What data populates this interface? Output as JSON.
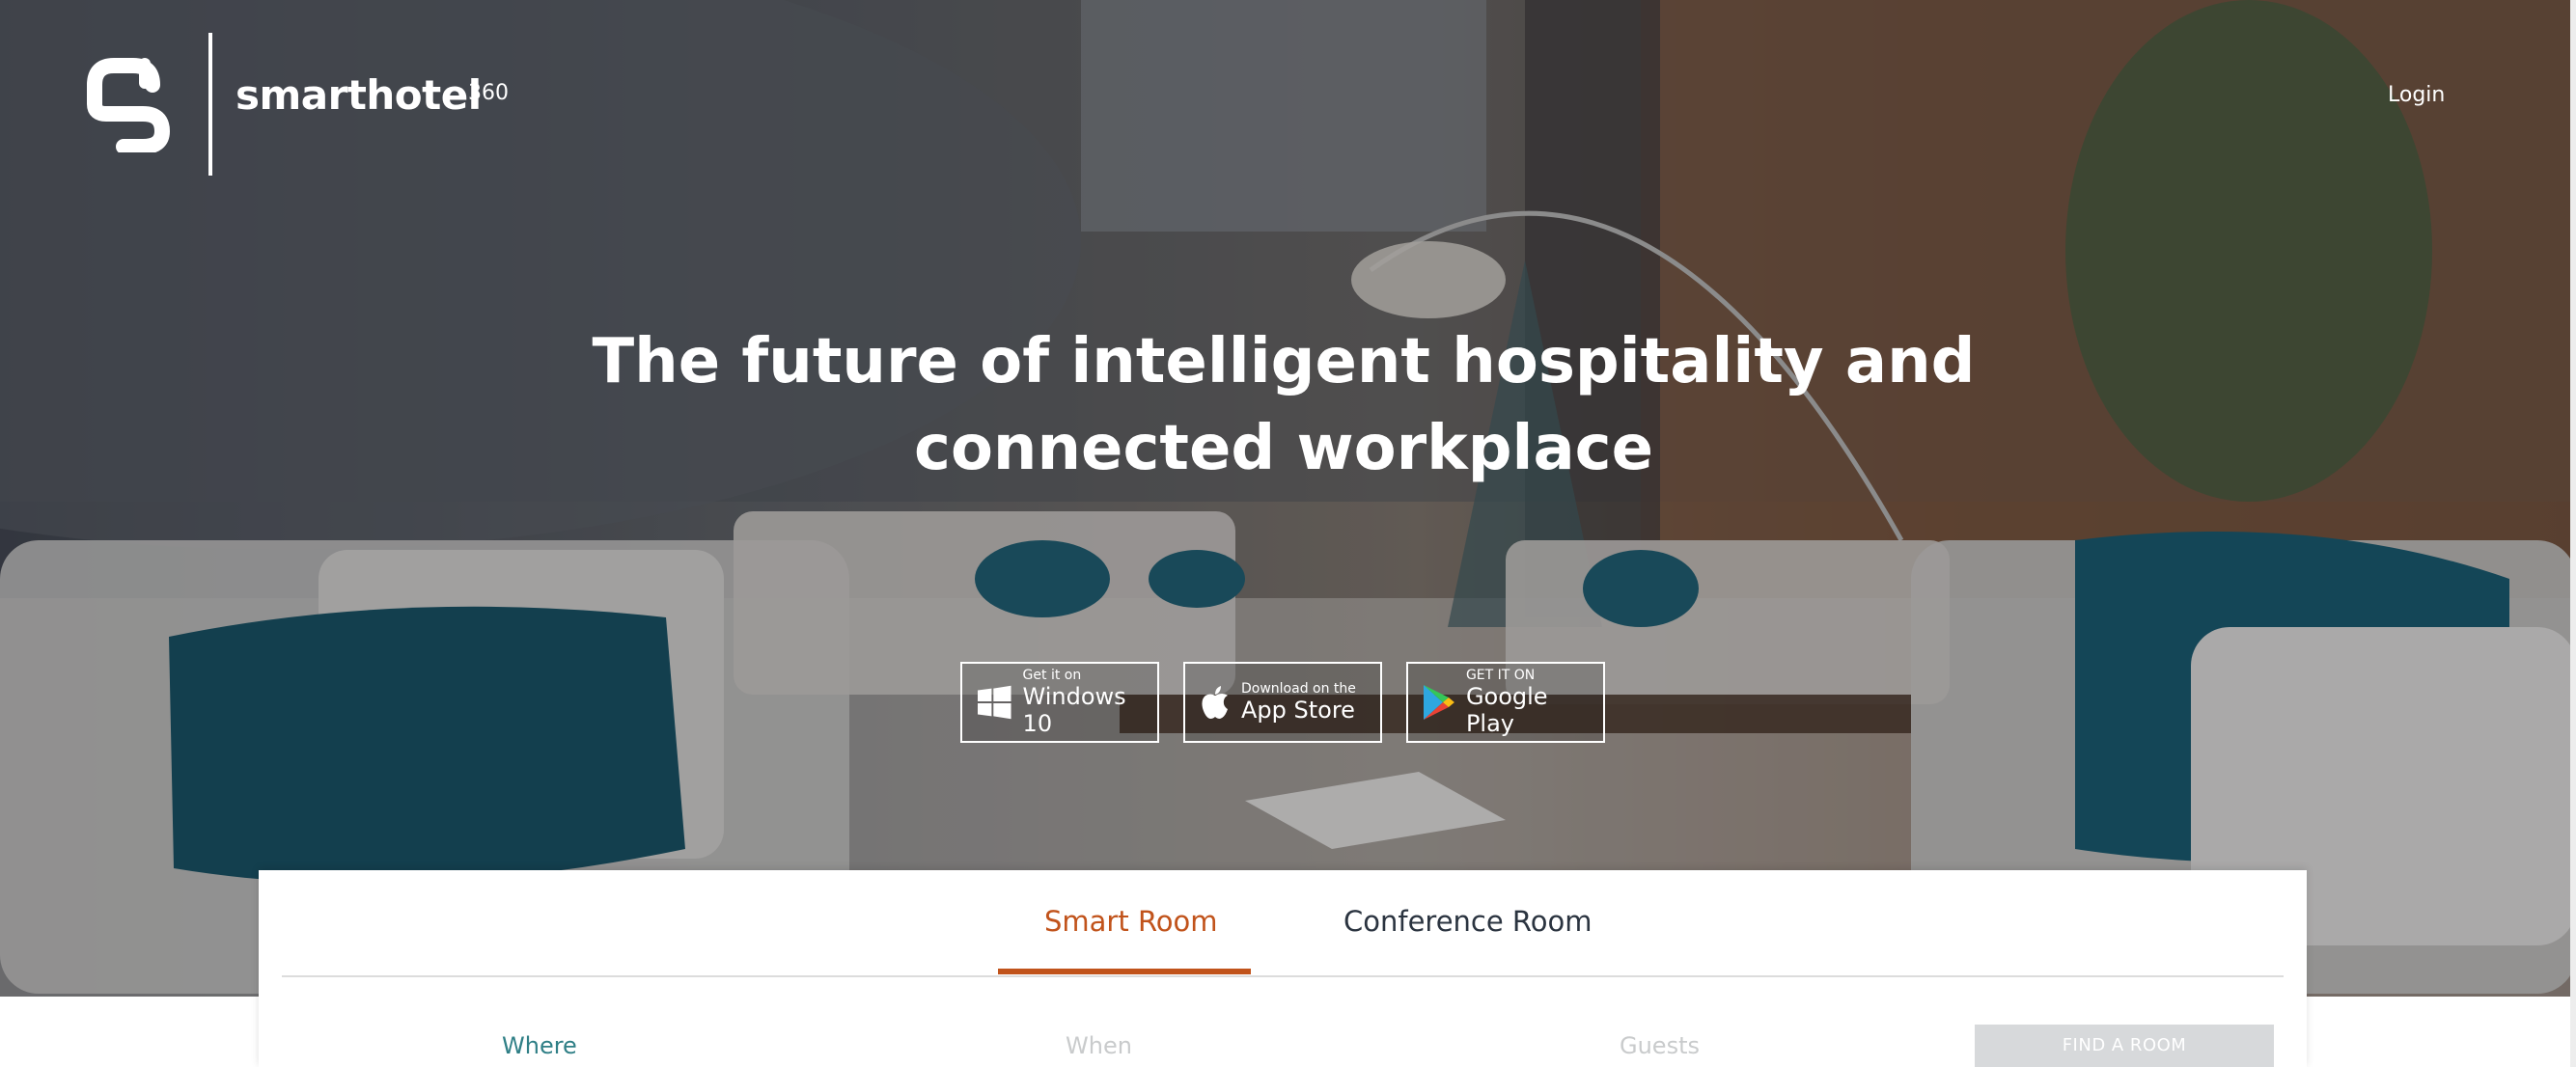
{
  "header": {
    "brand_name": "smarthotel",
    "brand_suffix": "360",
    "login_label": "Login"
  },
  "hero": {
    "headline": "The future of intelligent hospitality and connected workplace"
  },
  "store_buttons": [
    {
      "small": "Get it on",
      "big": "Windows 10",
      "icon": "windows-icon"
    },
    {
      "small": "Download on the",
      "big": "App Store",
      "icon": "apple-icon"
    },
    {
      "small": "GET IT ON",
      "big": "Google Play",
      "icon": "google-play-icon"
    }
  ],
  "search": {
    "tabs": [
      {
        "label": "Smart Room",
        "active": true
      },
      {
        "label": "Conference Room",
        "active": false
      }
    ],
    "fields": [
      {
        "label": "Where"
      },
      {
        "label": "When"
      },
      {
        "label": "Guests"
      }
    ],
    "find_button_label": "FIND A ROOM"
  },
  "colors": {
    "accent": "#c1531b",
    "where_label": "#2f7f86",
    "placeholder": "#c9cbcc",
    "find_button_bg": "#d7d9db"
  }
}
